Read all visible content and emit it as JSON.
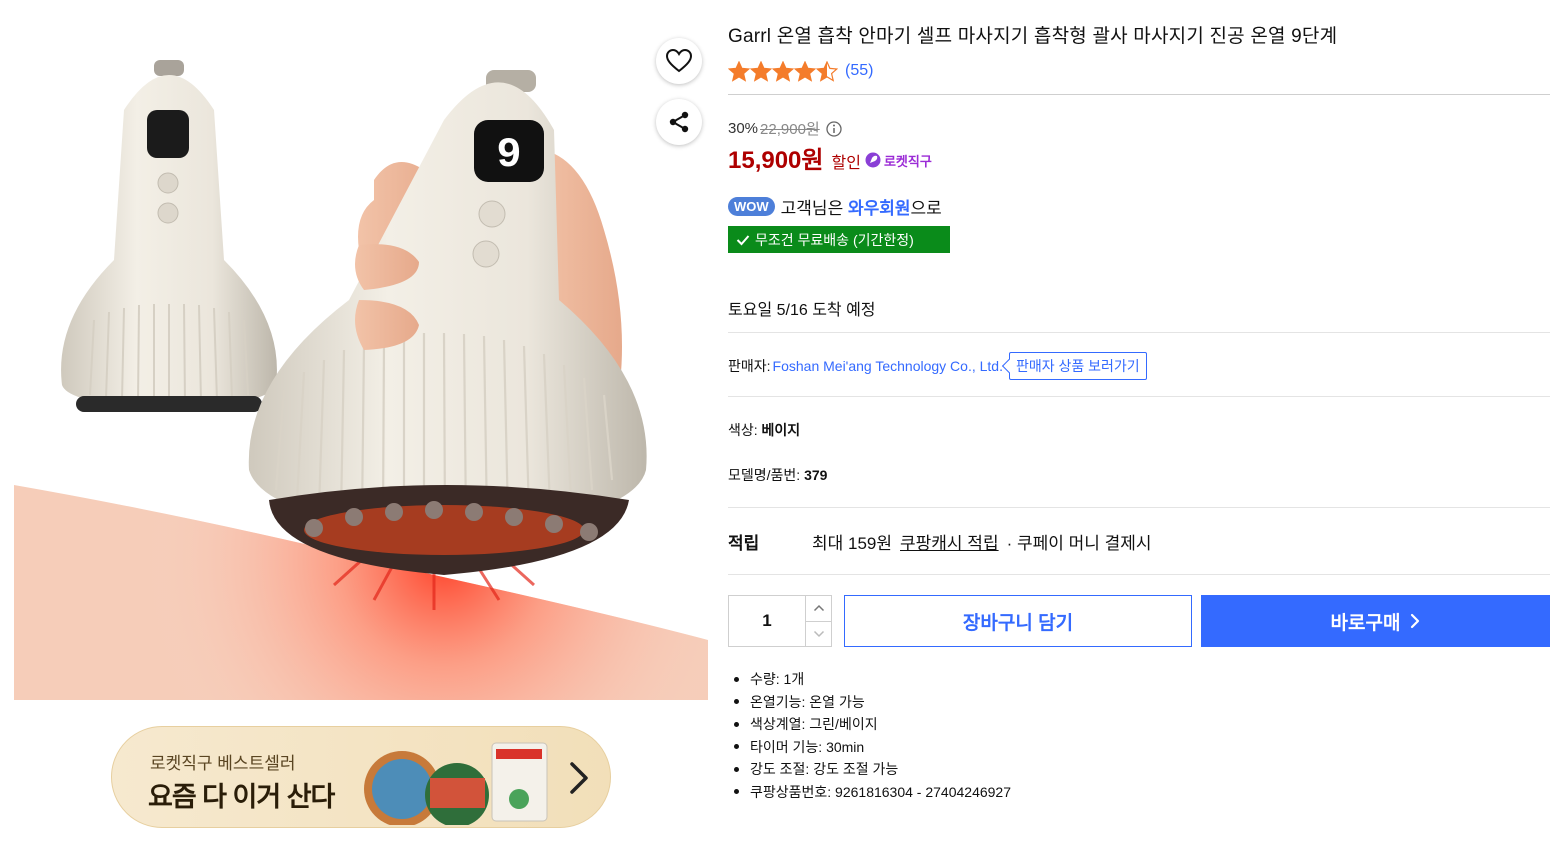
{
  "product": {
    "title": "Garrl 온열 흡착 안마기 셀프 마사지기 흡착형 괄사 마사지기 진공 온열 9단계",
    "rating_stars": 4.5,
    "review_count": "(55)",
    "display_digit": "9"
  },
  "price": {
    "discount_rate": "30%",
    "original_price": "22,900원",
    "sale_price": "15,900원",
    "sale_label": "할인",
    "rocket_label": "로켓직구"
  },
  "wow": {
    "badge": "WOW",
    "prefix": "고객님은 ",
    "member": "와우회원",
    "suffix": "으로"
  },
  "shipping": {
    "badge_text": "무조건 무료배송 (기간한정)"
  },
  "delivery": {
    "arrival_text": "토요일 5/16 도착 예정"
  },
  "seller": {
    "label": "판매자:",
    "name": "Foshan Mei'ang Technology Co., Ltd.",
    "button": "판매자 상품 보러가기"
  },
  "options": {
    "color_label": "색상:",
    "color_value": "베이지",
    "model_label": "모델명/품번:",
    "model_value": "379"
  },
  "reward": {
    "label": "적립",
    "amount_text": "최대 159원",
    "link": "쿠팡캐시 적립",
    "suffix": "· 쿠페이 머니 결제시"
  },
  "purchase": {
    "quantity": "1",
    "cart_label": "장바구니 담기",
    "buy_label": "바로구매"
  },
  "specs": [
    "수량: 1개",
    "온열기능: 온열 가능",
    "색상계열: 그린/베이지",
    "타이머 기능: 30min",
    "강도 조절: 강도 조절 가능",
    "쿠팡상품번호: 9261816304 - 27404246927"
  ],
  "banner": {
    "subtitle": "로켓직구 베스트셀러",
    "title": "요즘 다 이거 산다"
  },
  "icons": {
    "heart": "heart-icon",
    "share": "share-icon",
    "info": "info-icon",
    "check": "check-icon",
    "chevron_right": "chevron-right-icon",
    "chevron_up": "chevron-up-icon",
    "chevron_down": "chevron-down-icon",
    "rocket": "rocket-icon",
    "star": "star-icon"
  },
  "colors": {
    "brand_blue": "#346aff",
    "price_red": "#ae0000",
    "ship_green": "#0a8b1a",
    "rocket_purple": "#9b2bd6",
    "star_orange": "#f47c2b"
  }
}
